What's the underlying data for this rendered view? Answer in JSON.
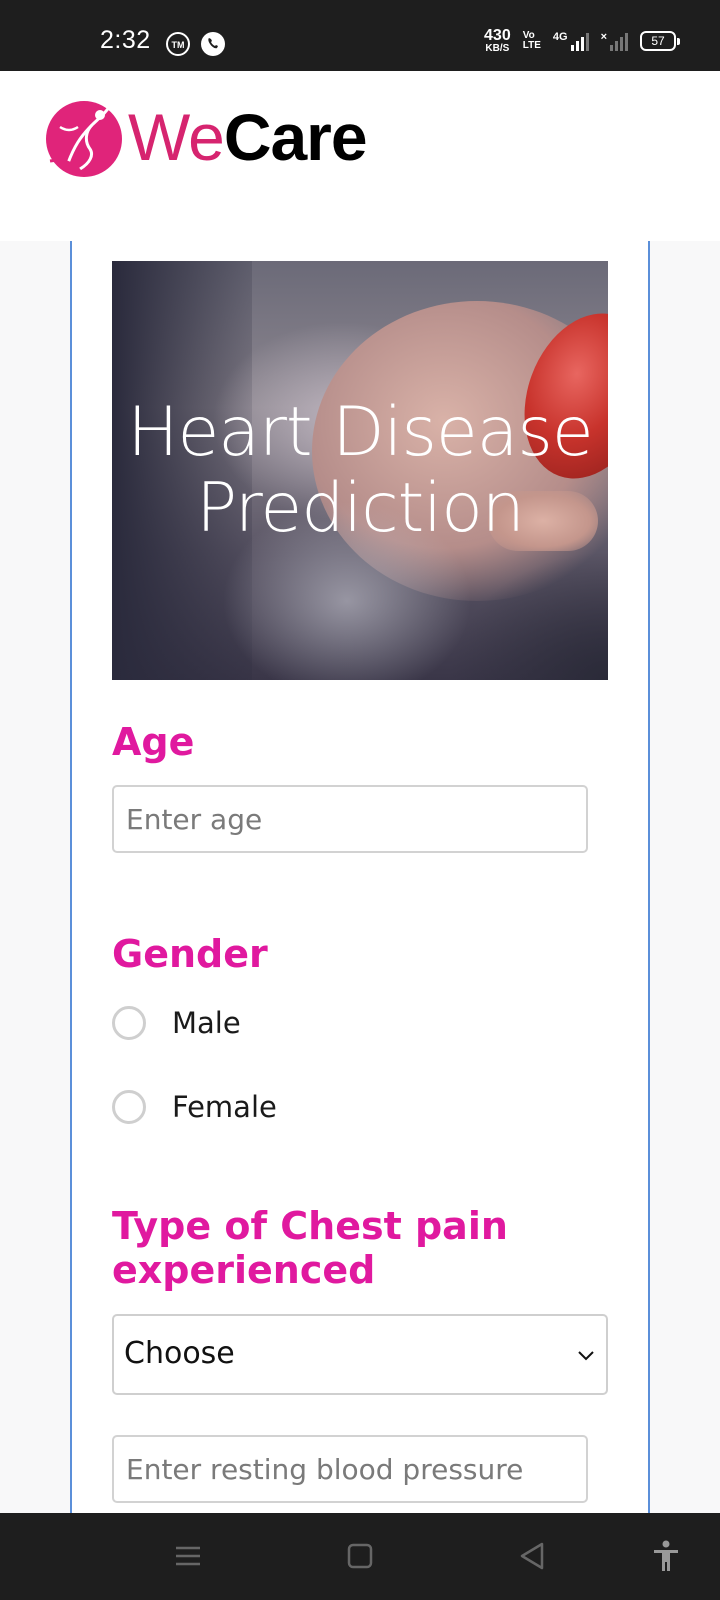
{
  "status_bar": {
    "time": "2:32",
    "net_speed_value": "430",
    "net_speed_unit": "KB/S",
    "volte_top": "Vo",
    "volte_bottom": "LTE",
    "network_type": "4G",
    "battery_level": "57"
  },
  "header": {
    "logo_we": "We",
    "logo_care": "Care"
  },
  "hero": {
    "title_line1": "Heart Disease",
    "title_line2": "Prediction"
  },
  "form": {
    "age_label": "Age",
    "age_placeholder": "Enter age",
    "age_value": "",
    "gender_label": "Gender",
    "gender_options": [
      {
        "label": "Male",
        "selected": false
      },
      {
        "label": "Female",
        "selected": false
      }
    ],
    "chest_pain_label_line1": "Type of Chest pain",
    "chest_pain_label_line2": "experienced",
    "chest_pain_selected": "Choose",
    "resting_bp_placeholder": "Enter resting blood pressure",
    "resting_bp_value": ""
  },
  "colors": {
    "accent_pink": "#e0199f",
    "logo_pink": "#d6246f",
    "card_border": "#5b8fd9"
  },
  "icons": {
    "status_left": [
      "mi-icon",
      "whatsapp-icon"
    ],
    "nav": [
      "menu-icon",
      "home-icon",
      "back-icon",
      "accessibility-icon"
    ]
  }
}
